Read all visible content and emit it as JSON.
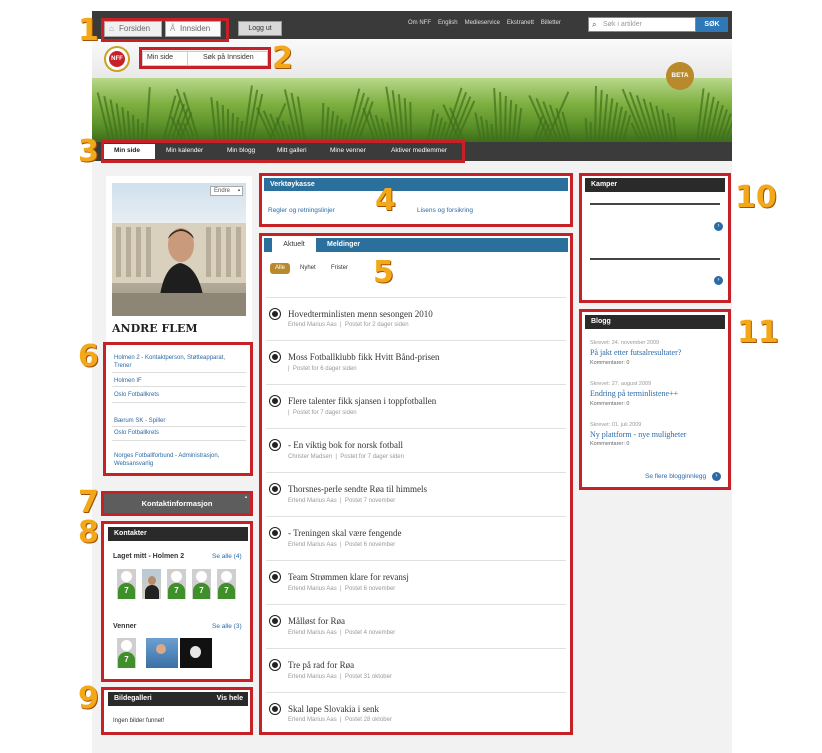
{
  "colors": {
    "accent": "#c62127",
    "callout": "#f3a81a",
    "link": "#2b6aa8",
    "dark": "#3b3b3b",
    "beta": "#b98a2c"
  },
  "callouts": [
    "1",
    "2",
    "3",
    "4",
    "5",
    "6",
    "7",
    "8",
    "9",
    "10",
    "11"
  ],
  "top_tabs": {
    "forsiden": "Forsiden",
    "innsiden": "Innsiden",
    "logout": "Logg ut"
  },
  "top_links": [
    "Om NFF",
    "English",
    "Medieservice",
    "Ekstranett",
    "Billetter"
  ],
  "search": {
    "placeholder": "Søk i artikler",
    "button": "SØK"
  },
  "sub_nav": {
    "min_side": "Min side",
    "sok_innsiden": "Søk på Innsiden"
  },
  "logo_text": "NFF",
  "beta": "BETA",
  "main_nav": [
    "Min side",
    "Min kalender",
    "Min blogg",
    "Mitt galleri",
    "Mine venner",
    "Aktiver medlemmer"
  ],
  "profile": {
    "edit": "Endre",
    "name": "ANDRE FLEM"
  },
  "affiliations": [
    "Holmen 2 - Kontaktperson, Støtteapparat, Trener",
    "Holmen IF",
    "Oslo Fotballkrets",
    "Bærum SK - Spiller",
    "Oslo Fotballkrets",
    "Norges Fotballforbund - Administrasjon, Websansvarlig"
  ],
  "contact_info": "Kontaktinformasjon",
  "contacts": {
    "title": "Kontakter",
    "team_label": "Laget mitt - Holmen 2",
    "team_see_all": "Se alle (4)",
    "friends_label": "Venner",
    "friends_see_all": "Se alle (3)",
    "avatar_number": "7"
  },
  "gallery": {
    "title": "Bildegalleri",
    "show_all": "Vis hele",
    "empty": "Ingen bilder funnet!"
  },
  "toolbox": {
    "title": "Verktøykasse",
    "link1": "Regler og retningslinjer",
    "link2": "Lisens og forsikring"
  },
  "feed": {
    "tabs": [
      "Aktuelt",
      "Meldinger"
    ],
    "filters": [
      "Alle",
      "Nyhet",
      "Frister"
    ],
    "items": [
      {
        "title": "Hovedterminlisten menn sesongen 2010",
        "author": "Erlend Marius Aas",
        "posted": "Postet for 2 dager siden"
      },
      {
        "title": "Moss Fotballklubb fikk Hvitt Bånd-prisen",
        "author": "",
        "posted": "Postet for 6 dager siden"
      },
      {
        "title": "Flere talenter fikk sjansen i toppfotballen",
        "author": "",
        "posted": "Postet for 7 dager siden"
      },
      {
        "title": "- En viktig bok for norsk fotball",
        "author": "Christer Madsen",
        "posted": "Postet for 7 dager siden"
      },
      {
        "title": "Thorsnes-perle sendte Røa til himmels",
        "author": "Erlend Marius Aas",
        "posted": "Postet 7 november"
      },
      {
        "title": "- Treningen skal være fengende",
        "author": "Erlend Marius Aas",
        "posted": "Postet 6 november"
      },
      {
        "title": "Team Strømmen klare for revansj",
        "author": "Erlend Marius Aas",
        "posted": "Postet 6 november"
      },
      {
        "title": "Målløst for Røa",
        "author": "Erlend Marius Aas",
        "posted": "Postet 4 november"
      },
      {
        "title": "Tre på rad for Røa",
        "author": "Erlend Marius Aas",
        "posted": "Postet 31 oktober"
      },
      {
        "title": "Skal løpe Slovakia i senk",
        "author": "Erlend Marius Aas",
        "posted": "Postet 28 oktober"
      }
    ]
  },
  "matches": {
    "title": "Kamper"
  },
  "blog": {
    "title": "Blogg",
    "posts": [
      {
        "date": "Skrevet: 24. november 2009",
        "title": "På jakt etter futsalresultater?",
        "comments": "Kommentarer: 0"
      },
      {
        "date": "Skrevet: 27. august 2009",
        "title": "Endring på terminlistene++",
        "comments": "Kommentarer: 0"
      },
      {
        "date": "Skrevet: 01. juli 2009",
        "title": "Ny plattform - nye muligheter",
        "comments": "Kommentarer: 0"
      }
    ],
    "more": "Se flere blogginnlegg"
  }
}
